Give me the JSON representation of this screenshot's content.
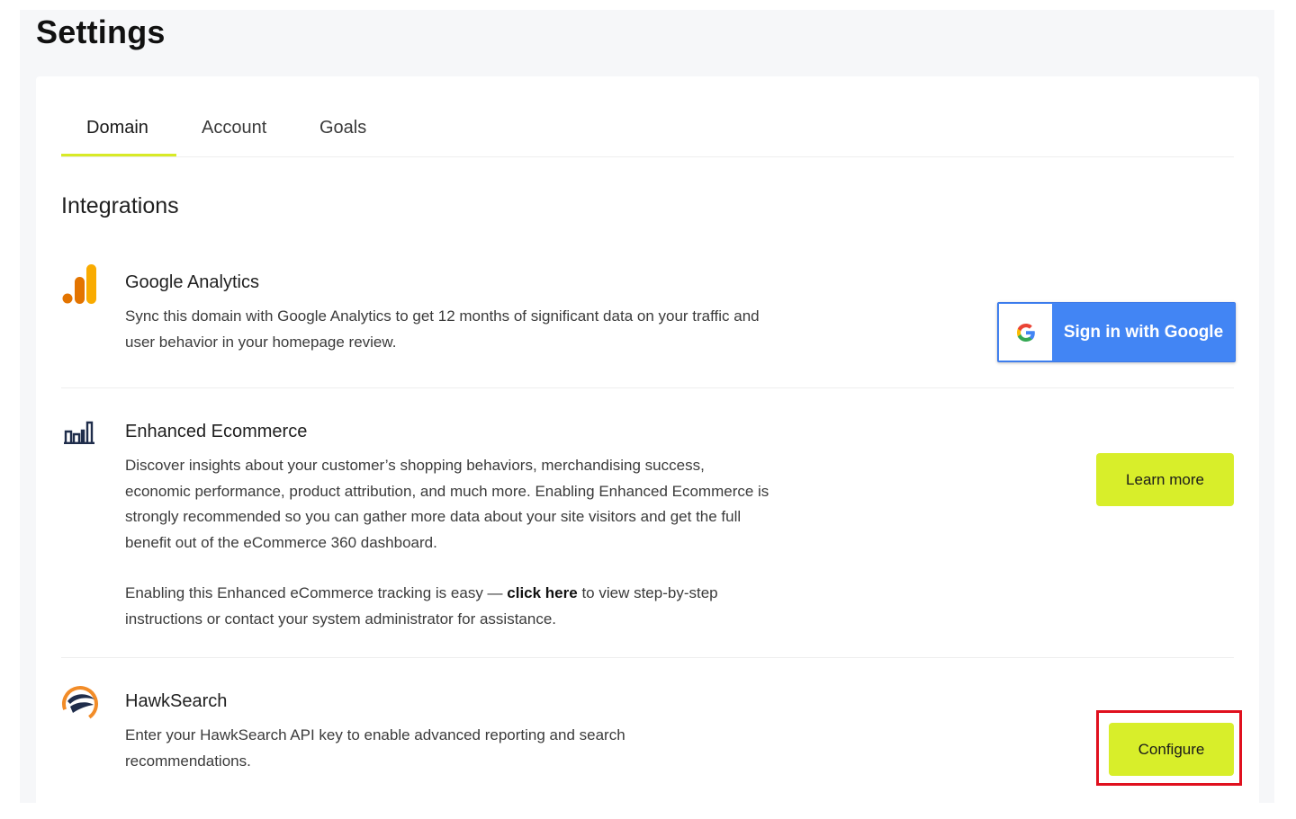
{
  "page": {
    "title": "Settings"
  },
  "tabs": [
    {
      "label": "Domain",
      "active": true
    },
    {
      "label": "Account",
      "active": false
    },
    {
      "label": "Goals",
      "active": false
    }
  ],
  "section": {
    "title": "Integrations"
  },
  "integrations": [
    {
      "name": "Google Analytics",
      "icon": "google-analytics-icon",
      "description": "Sync this domain with Google Analytics to get 12 months of significant data on your traffic and user behavior in your homepage review.",
      "button": {
        "label": "Sign in with Google",
        "icon": "google-g-icon"
      }
    },
    {
      "name": "Enhanced Ecommerce",
      "icon": "bar-chart-icon",
      "description": "Discover insights about your customer’s shopping behaviors, merchandising success, economic performance, product attribution, and much more. Enabling Enhanced Ecommerce is strongly recommended so you can gather more data about your site visitors and get the full benefit out of the eCommerce 360 dashboard.",
      "note_prefix": "Enabling this Enhanced eCommerce tracking is easy — ",
      "note_link": "click here",
      "note_suffix": " to view step-by-step instructions or contact your system administrator for assistance.",
      "button": {
        "label": "Learn more"
      }
    },
    {
      "name": "HawkSearch",
      "icon": "hawksearch-logo-icon",
      "description": "Enter your HawkSearch API key to enable advanced reporting and search recommendations.",
      "button": {
        "label": "Configure"
      }
    }
  ],
  "colors": {
    "accent_lime": "#d8ee2a",
    "google_blue": "#4285f4",
    "highlight_red": "#e0101e",
    "ga_orange": "#f9ab00",
    "ga_orange_dark": "#e37400",
    "hawk_orange": "#f28c28",
    "hawk_navy": "#1f2d4b"
  }
}
